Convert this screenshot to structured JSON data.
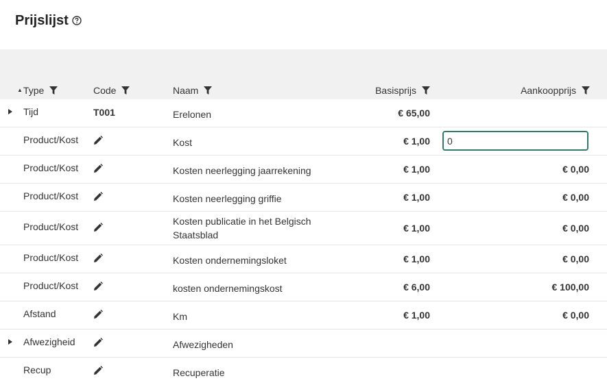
{
  "page": {
    "title": "Prijslijst"
  },
  "colors": {
    "accent": "#2f7a6b",
    "toolbar_bg": "#f1f1f1",
    "row_border": "#e6e6e6"
  },
  "columns": {
    "type": "Type",
    "code": "Code",
    "naam": "Naam",
    "basisprijs": "Basisprijs",
    "aankoopprijs": "Aankoopprijs"
  },
  "rows": [
    {
      "type": "Tijd",
      "code": "T001",
      "naam": "Erelonen",
      "basisprijs": "€ 65,00",
      "aankoopprijs": ""
    },
    {
      "type": "Product/Kost",
      "naam": "Kost",
      "basisprijs": "€ 1,00",
      "aankoopprijs_input": "0"
    },
    {
      "type": "Product/Kost",
      "naam": "Kosten neerlegging jaarrekening",
      "basisprijs": "€ 1,00",
      "aankoopprijs": "€ 0,00"
    },
    {
      "type": "Product/Kost",
      "naam": "Kosten neerlegging griffie",
      "basisprijs": "€ 1,00",
      "aankoopprijs": "€ 0,00"
    },
    {
      "type": "Product/Kost",
      "naam": "Kosten publicatie in het Belgisch Staatsblad",
      "basisprijs": "€ 1,00",
      "aankoopprijs": "€ 0,00"
    },
    {
      "type": "Product/Kost",
      "naam": "Kosten ondernemingsloket",
      "basisprijs": "€ 1,00",
      "aankoopprijs": "€ 0,00"
    },
    {
      "type": "Product/Kost",
      "naam": "kosten ondernemingskost",
      "basisprijs": "€ 6,00",
      "aankoopprijs": "€ 100,00"
    },
    {
      "type": "Afstand",
      "naam": "Km",
      "basisprijs": "€ 1,00",
      "aankoopprijs": "€ 0,00"
    },
    {
      "type": "Afwezigheid",
      "naam": "Afwezigheden",
      "basisprijs": "",
      "aankoopprijs": ""
    },
    {
      "type": "Recup",
      "naam": "Recuperatie",
      "basisprijs": "",
      "aankoopprijs": ""
    }
  ]
}
